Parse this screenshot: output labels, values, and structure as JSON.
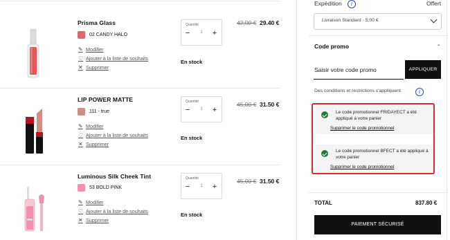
{
  "products": [
    {
      "name": "Prisma Glass",
      "shade": "02 CANDY HALO",
      "swatch_color": "#e2646c",
      "quantity_label": "Quantité",
      "quantity": "1",
      "stock": "En stock",
      "old_price": "42,00 €",
      "new_price": "29.40 €"
    },
    {
      "name": "LIP POWER MATTE",
      "shade": "111 - true",
      "swatch_color": "#c88f86",
      "quantity_label": "Quantité",
      "quantity": "1",
      "stock": "En stock",
      "old_price": "45,00 €",
      "new_price": "31.50 €"
    },
    {
      "name": "Luminous Silk Cheek Tint",
      "shade": "53 BOLD PINK",
      "swatch_color": "#ef90ad",
      "quantity_label": "Quantité",
      "quantity": "1",
      "stock": "En stock",
      "old_price": "45,00 €",
      "new_price": "31.50 €"
    }
  ],
  "item_actions": {
    "modify": "Modifier",
    "wishlist": "Ajouter à la liste de souhaits",
    "remove": "Supprimer"
  },
  "summary": {
    "shipping_label": "Expédition",
    "shipping_value": "Offert",
    "shipping_select": "Livraison Standard - 5,00 €",
    "promo_title": "Code promo",
    "promo_toggle": "-",
    "promo_placeholder": "Saisir votre code promo",
    "apply_button": "APPLIQUER",
    "conditions": "Des conditions et restrictions s'appliquent.",
    "promo_messages": [
      {
        "text": "Le code promotionnel FRIDAYECT a été appliqué à votre panier",
        "link": "Supprimer le code promotionnel"
      },
      {
        "text": "Le code promotionnel BFECT a été appliqué à votre panier",
        "link": "Supprimer le code promotionnel"
      }
    ],
    "total_label": "TOTAL",
    "total_value": "837.80 €",
    "pay_button": "PAIEMENT SÉCURISÉ"
  },
  "colors": {
    "highlight": "#d42b2b",
    "success": "#1f7a3a",
    "button": "#111111"
  }
}
